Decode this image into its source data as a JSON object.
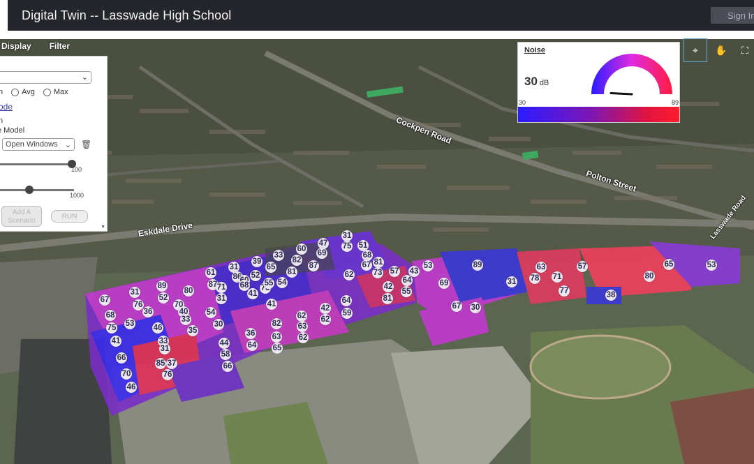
{
  "header": {
    "title": "Digital Twin -- Lasswade High School",
    "sign_in_label": "Sign In"
  },
  "menu": {
    "items": [
      "Display",
      "Filter"
    ]
  },
  "panel": {
    "stat_options": [
      "n",
      "Avg",
      "Max"
    ],
    "mode_link": "ode",
    "tick_label": "n",
    "model_label": "e Model",
    "window_select": "Open Windows",
    "slider1_max": "100",
    "slider2_max": "1000",
    "slider1_fraction": 0.95,
    "slider2_fraction": 0.4,
    "add_button": "Add A Scenario",
    "run_button": "RUN"
  },
  "gauge": {
    "title": "Noise",
    "value": "30",
    "unit": "dB",
    "min": "30",
    "max": "89",
    "current": 30
  },
  "streets": [
    "Eskdale Drive",
    "Polton Street",
    "Cockpen Road",
    "Lasswade Road"
  ],
  "colors": {
    "accent_blue": "#2a1cff",
    "accent_red": "#ff1c2c",
    "accent_magenta": "#c21fd0",
    "header": "#25262c"
  },
  "icons": [
    "map-pin-icon",
    "hand-icon",
    "fullscreen-icon",
    "trash-icon",
    "chevron-down-icon"
  ],
  "markers": [
    "67",
    "31",
    "89",
    "76",
    "52",
    "36",
    "70",
    "80",
    "61",
    "87",
    "31",
    "86",
    "39",
    "60",
    "52",
    "65",
    "33",
    "60",
    "82",
    "47",
    "69",
    "31",
    "75",
    "51",
    "68",
    "81",
    "67",
    "73",
    "57",
    "43",
    "53",
    "89",
    "63",
    "78",
    "71",
    "57",
    "80",
    "65",
    "53",
    "68",
    "75",
    "53",
    "41",
    "46",
    "40",
    "33",
    "30",
    "71",
    "31",
    "68",
    "41",
    "73",
    "55",
    "54",
    "81",
    "87",
    "62",
    "42",
    "81",
    "64",
    "55",
    "69",
    "66",
    "70",
    "46",
    "33",
    "31",
    "85",
    "37",
    "76",
    "35",
    "54",
    "44",
    "58",
    "66",
    "36",
    "64",
    "82",
    "62",
    "63",
    "63",
    "65",
    "62",
    "42",
    "62",
    "64",
    "59",
    "41",
    "31",
    "77",
    "38",
    "67",
    "30"
  ]
}
